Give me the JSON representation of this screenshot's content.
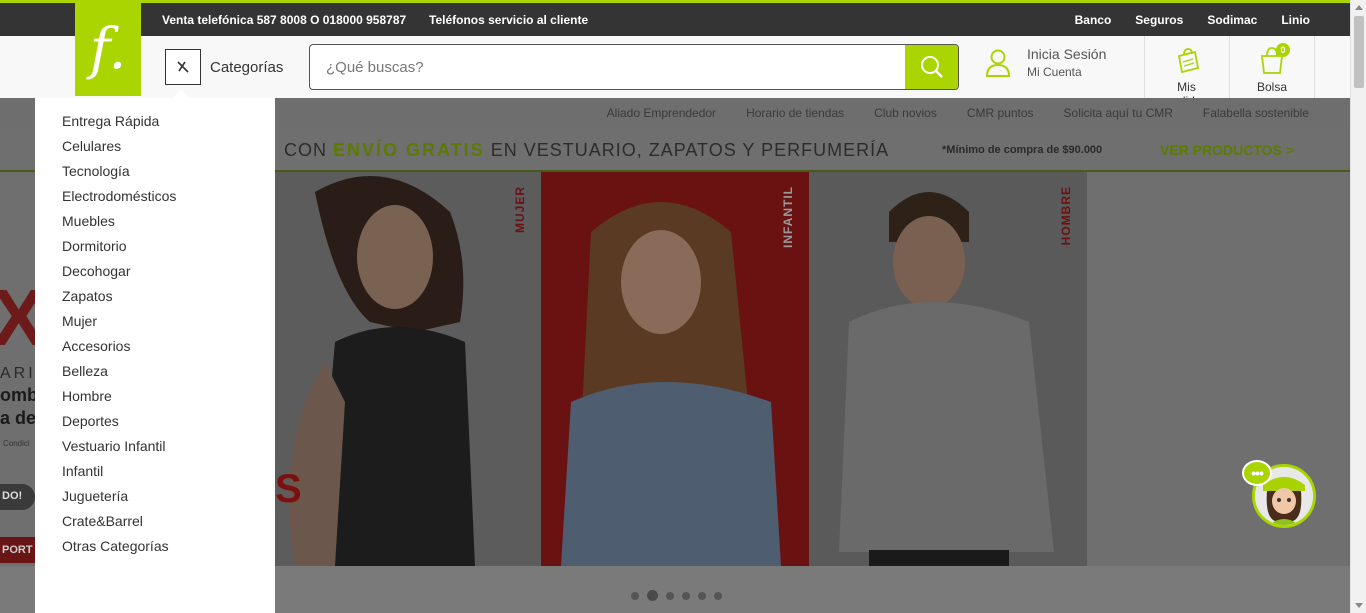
{
  "topbar": {
    "phone_sales": "Venta telefónica 587 8008 O 018000 958787",
    "customer_service": "Teléfonos servicio al cliente",
    "links": [
      "Banco",
      "Seguros",
      "Sodimac",
      "Linio"
    ]
  },
  "header": {
    "logo": "f.",
    "categories_label": "Categorías",
    "search_placeholder": "¿Qué buscas?",
    "login_label": "Inicia Sesión",
    "account_label": "Mi Cuenta",
    "orders_label": "Mis pedidos",
    "bag_label": "Bolsa",
    "bag_count": "0"
  },
  "subnav": {
    "links": [
      "Aliado Emprendedor",
      "Horario de tiendas",
      "Club novios",
      "CMR puntos",
      "Solicita aquí tu CMR",
      "Falabella sostenible"
    ]
  },
  "promo": {
    "text_prefix": "CON ",
    "text_highlight": "ENVÍO GRATIS",
    "text_suffix": " EN VESTUARIO, ZAPATOS  Y PERFUMERÍA",
    "minimum": "*Mínimo de compra de $90.000",
    "cta": "VER PRODUCTOS >"
  },
  "hero": {
    "left_partial": {
      "big": "X",
      "line1": "ARI",
      "line2": "omb",
      "line3": "a de",
      "line4": "Condici",
      "pill1": "DO!",
      "pill2": "PORT"
    },
    "panels": [
      {
        "label": "MUJER"
      },
      {
        "label": "INFANTIL"
      },
      {
        "label": "HOMBRE"
      }
    ],
    "woman_fragment": "S",
    "slides": 6,
    "active_slide": 1
  },
  "menu": {
    "items": [
      "Entrega Rápida",
      "Celulares",
      "Tecnología",
      "Electrodomésticos",
      "Muebles",
      "Dormitorio",
      "Decohogar",
      "Zapatos",
      "Mujer",
      "Accesorios",
      "Belleza",
      "Hombre",
      "Deportes",
      "Vestuario Infantil",
      "Infantil",
      "Juguetería",
      "Crate&Barrel",
      "Otras Categorías"
    ]
  },
  "colors": {
    "brand_green": "#aad500",
    "topbar_bg": "#343434",
    "overlay_gray": "#7a7a7a"
  },
  "icons": {
    "logo": "falabella-logo",
    "categories": "close-x-icon",
    "search": "search-icon",
    "user": "user-icon",
    "orders": "shopping-bag-icon",
    "bag": "bag-icon",
    "chat": "chat-assistant-icon"
  }
}
